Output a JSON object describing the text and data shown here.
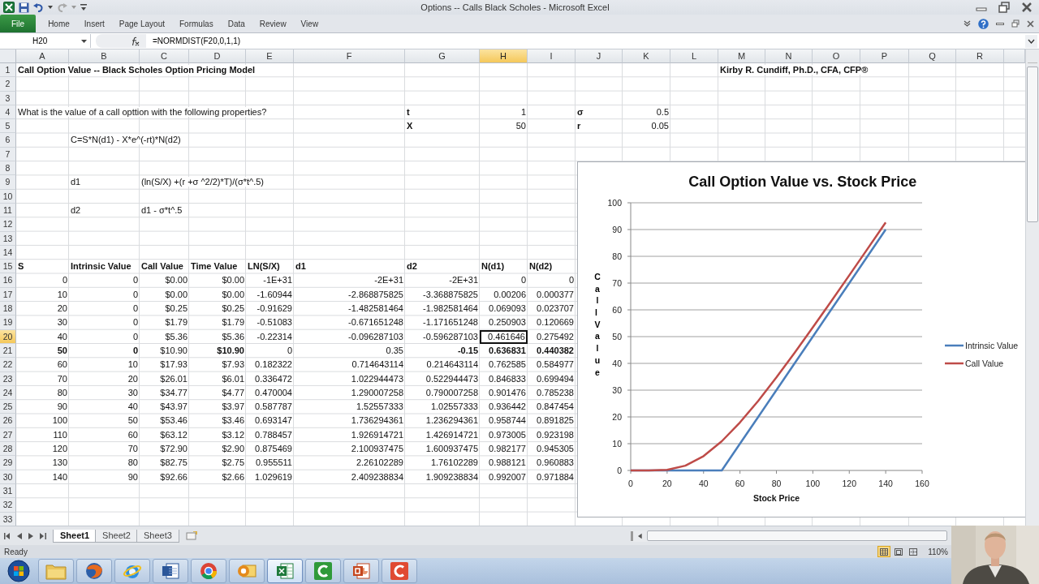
{
  "window": {
    "title": "Options -- Calls Black Scholes - Microsoft Excel"
  },
  "ribbon": {
    "tabs": [
      {
        "label": "File",
        "kind": "file"
      },
      {
        "label": "Home",
        "kind": "tab"
      },
      {
        "label": "Insert",
        "kind": "tab"
      },
      {
        "label": "Page Layout",
        "kind": "tab"
      },
      {
        "label": "Formulas",
        "kind": "tab"
      },
      {
        "label": "Data",
        "kind": "tab"
      },
      {
        "label": "Review",
        "kind": "tab"
      },
      {
        "label": "View",
        "kind": "tab"
      }
    ]
  },
  "formula_bar": {
    "name_box": "H20",
    "formula": "=NORMDIST(F20,0,1,1)"
  },
  "sheet": {
    "columns": [
      {
        "label": "A",
        "selected": false
      },
      {
        "label": "B",
        "selected": false
      },
      {
        "label": "C",
        "selected": false
      },
      {
        "label": "D",
        "selected": false
      },
      {
        "label": "E",
        "selected": false
      },
      {
        "label": "F",
        "selected": false
      },
      {
        "label": "G",
        "selected": false
      },
      {
        "label": "H",
        "selected": true
      },
      {
        "label": "I",
        "selected": false
      },
      {
        "label": "J",
        "selected": false
      },
      {
        "label": "K",
        "selected": false
      },
      {
        "label": "L",
        "selected": false
      },
      {
        "label": "M",
        "selected": false
      },
      {
        "label": "N",
        "selected": false
      },
      {
        "label": "O",
        "selected": false
      },
      {
        "label": "P",
        "selected": false
      },
      {
        "label": "Q",
        "selected": false
      },
      {
        "label": "R",
        "selected": false
      }
    ],
    "rows": [
      {
        "number": "1",
        "selected": false,
        "cells": [
          {
            "text": "Call Option Value -- Black Scholes Option Pricing Model",
            "kind": "text",
            "bold": true
          },
          null,
          null,
          null,
          null,
          null,
          null,
          null,
          null,
          null,
          null,
          null,
          {
            "text": "Kirby R. Cundiff, Ph.D., CFA, CFP®",
            "kind": "text",
            "bold": true
          }
        ]
      },
      {
        "number": "2",
        "selected": false,
        "cells": []
      },
      {
        "number": "3",
        "selected": false,
        "cells": []
      },
      {
        "number": "4",
        "selected": false,
        "cells": [
          {
            "text": "What is the value of a call opttion with the following properties?",
            "kind": "text",
            "bold": false
          },
          null,
          null,
          null,
          null,
          null,
          {
            "text": "t",
            "kind": "text",
            "bold": true
          },
          {
            "text": "1",
            "kind": "number",
            "bold": false
          },
          null,
          {
            "text": "σ",
            "kind": "text",
            "bold": true
          },
          {
            "text": "0.5",
            "kind": "number",
            "bold": false
          }
        ]
      },
      {
        "number": "5",
        "selected": false,
        "cells": [
          null,
          null,
          null,
          null,
          null,
          null,
          {
            "text": "X",
            "kind": "text",
            "bold": true
          },
          {
            "text": "50",
            "kind": "number",
            "bold": false
          },
          null,
          {
            "text": "r",
            "kind": "text",
            "bold": true
          },
          {
            "text": "0.05",
            "kind": "number",
            "bold": false
          }
        ]
      },
      {
        "number": "6",
        "selected": false,
        "cells": [
          null,
          {
            "text": "C=S*N(d1) - X*e^(-rt)*N(d2)",
            "kind": "text",
            "bold": false
          }
        ]
      },
      {
        "number": "7",
        "selected": false,
        "cells": []
      },
      {
        "number": "8",
        "selected": false,
        "cells": []
      },
      {
        "number": "9",
        "selected": false,
        "cells": [
          null,
          {
            "text": "d1",
            "kind": "text",
            "bold": false
          },
          {
            "text": "(ln(S/X) +(r +σ ^2/2)*T)/(σ*t^.5)",
            "kind": "text",
            "bold": false
          }
        ]
      },
      {
        "number": "10",
        "selected": false,
        "cells": []
      },
      {
        "number": "11",
        "selected": false,
        "cells": [
          null,
          {
            "text": "d2",
            "kind": "text",
            "bold": false
          },
          {
            "text": "d1 - σ*t^.5",
            "kind": "text",
            "bold": false
          }
        ]
      },
      {
        "number": "12",
        "selected": false,
        "cells": []
      },
      {
        "number": "13",
        "selected": false,
        "cells": []
      },
      {
        "number": "14",
        "selected": false,
        "cells": []
      },
      {
        "number": "15",
        "selected": false,
        "cells": [
          {
            "text": "S",
            "kind": "text",
            "bold": true
          },
          {
            "text": "Intrinsic Value",
            "kind": "text",
            "bold": true
          },
          {
            "text": "Call Value",
            "kind": "text",
            "bold": true
          },
          {
            "text": "Time Value",
            "kind": "text",
            "bold": true
          },
          {
            "text": "LN(S/X)",
            "kind": "text",
            "bold": true
          },
          {
            "text": "d1",
            "kind": "text",
            "bold": true
          },
          {
            "text": "d2",
            "kind": "text",
            "bold": true
          },
          {
            "text": "N(d1)",
            "kind": "text",
            "bold": true
          },
          {
            "text": "N(d2)",
            "kind": "text",
            "bold": true
          }
        ]
      },
      {
        "number": "16",
        "selected": false,
        "cells": [
          {
            "text": "0",
            "kind": "number",
            "bold": false
          },
          {
            "text": "0",
            "kind": "number",
            "bold": false
          },
          {
            "text": "$0.00",
            "kind": "number",
            "bold": false
          },
          {
            "text": "$0.00",
            "kind": "number",
            "bold": false
          },
          {
            "text": "-1E+31",
            "kind": "number",
            "bold": false
          },
          {
            "text": "-2E+31",
            "kind": "number",
            "bold": false
          },
          {
            "text": "-2E+31",
            "kind": "number",
            "bold": false
          },
          {
            "text": "0",
            "kind": "number",
            "bold": false
          },
          {
            "text": "0",
            "kind": "number",
            "bold": false
          }
        ]
      },
      {
        "number": "17",
        "selected": false,
        "cells": [
          {
            "text": "10",
            "kind": "number",
            "bold": false
          },
          {
            "text": "0",
            "kind": "number",
            "bold": false
          },
          {
            "text": "$0.00",
            "kind": "number",
            "bold": false
          },
          {
            "text": "$0.00",
            "kind": "number",
            "bold": false
          },
          {
            "text": "-1.60944",
            "kind": "number",
            "bold": false
          },
          {
            "text": "-2.868875825",
            "kind": "number",
            "bold": false
          },
          {
            "text": "-3.368875825",
            "kind": "number",
            "bold": false
          },
          {
            "text": "0.00206",
            "kind": "number",
            "bold": false
          },
          {
            "text": "0.000377",
            "kind": "number",
            "bold": false
          }
        ]
      },
      {
        "number": "18",
        "selected": false,
        "cells": [
          {
            "text": "20",
            "kind": "number",
            "bold": false
          },
          {
            "text": "0",
            "kind": "number",
            "bold": false
          },
          {
            "text": "$0.25",
            "kind": "number",
            "bold": false
          },
          {
            "text": "$0.25",
            "kind": "number",
            "bold": false
          },
          {
            "text": "-0.91629",
            "kind": "number",
            "bold": false
          },
          {
            "text": "-1.482581464",
            "kind": "number",
            "bold": false
          },
          {
            "text": "-1.982581464",
            "kind": "number",
            "bold": false
          },
          {
            "text": "0.069093",
            "kind": "number",
            "bold": false
          },
          {
            "text": "0.023707",
            "kind": "number",
            "bold": false
          }
        ]
      },
      {
        "number": "19",
        "selected": false,
        "cells": [
          {
            "text": "30",
            "kind": "number",
            "bold": false
          },
          {
            "text": "0",
            "kind": "number",
            "bold": false
          },
          {
            "text": "$1.79",
            "kind": "number",
            "bold": false
          },
          {
            "text": "$1.79",
            "kind": "number",
            "bold": false
          },
          {
            "text": "-0.51083",
            "kind": "number",
            "bold": false
          },
          {
            "text": "-0.671651248",
            "kind": "number",
            "bold": false
          },
          {
            "text": "-1.171651248",
            "kind": "number",
            "bold": false
          },
          {
            "text": "0.250903",
            "kind": "number",
            "bold": false
          },
          {
            "text": "0.120669",
            "kind": "number",
            "bold": false
          }
        ]
      },
      {
        "number": "20",
        "selected": true,
        "cells": [
          {
            "text": "40",
            "kind": "number",
            "bold": false
          },
          {
            "text": "0",
            "kind": "number",
            "bold": false
          },
          {
            "text": "$5.36",
            "kind": "number",
            "bold": false
          },
          {
            "text": "$5.36",
            "kind": "number",
            "bold": false
          },
          {
            "text": "-0.22314",
            "kind": "number",
            "bold": false
          },
          {
            "text": "-0.096287103",
            "kind": "number",
            "bold": false
          },
          {
            "text": "-0.596287103",
            "kind": "number",
            "bold": false
          },
          {
            "text": "0.461646",
            "kind": "number",
            "bold": false
          },
          {
            "text": "0.275492",
            "kind": "number",
            "bold": false
          }
        ]
      },
      {
        "number": "21",
        "selected": false,
        "cells": [
          {
            "text": "50",
            "kind": "number",
            "bold": true
          },
          {
            "text": "0",
            "kind": "number",
            "bold": true
          },
          {
            "text": "$10.90",
            "kind": "number",
            "bold": false
          },
          {
            "text": "$10.90",
            "kind": "number",
            "bold": true
          },
          {
            "text": "0",
            "kind": "number",
            "bold": false
          },
          {
            "text": "0.35",
            "kind": "number",
            "bold": false
          },
          {
            "text": "-0.15",
            "kind": "number",
            "bold": true
          },
          {
            "text": "0.636831",
            "kind": "number",
            "bold": true
          },
          {
            "text": "0.440382",
            "kind": "number",
            "bold": true
          }
        ]
      },
      {
        "number": "22",
        "selected": false,
        "cells": [
          {
            "text": "60",
            "kind": "number",
            "bold": false
          },
          {
            "text": "10",
            "kind": "number",
            "bold": false
          },
          {
            "text": "$17.93",
            "kind": "number",
            "bold": false
          },
          {
            "text": "$7.93",
            "kind": "number",
            "bold": false
          },
          {
            "text": "0.182322",
            "kind": "number",
            "bold": false
          },
          {
            "text": "0.714643114",
            "kind": "number",
            "bold": false
          },
          {
            "text": "0.214643114",
            "kind": "number",
            "bold": false
          },
          {
            "text": "0.762585",
            "kind": "number",
            "bold": false
          },
          {
            "text": "0.584977",
            "kind": "number",
            "bold": false
          }
        ]
      },
      {
        "number": "23",
        "selected": false,
        "cells": [
          {
            "text": "70",
            "kind": "number",
            "bold": false
          },
          {
            "text": "20",
            "kind": "number",
            "bold": false
          },
          {
            "text": "$26.01",
            "kind": "number",
            "bold": false
          },
          {
            "text": "$6.01",
            "kind": "number",
            "bold": false
          },
          {
            "text": "0.336472",
            "kind": "number",
            "bold": false
          },
          {
            "text": "1.022944473",
            "kind": "number",
            "bold": false
          },
          {
            "text": "0.522944473",
            "kind": "number",
            "bold": false
          },
          {
            "text": "0.846833",
            "kind": "number",
            "bold": false
          },
          {
            "text": "0.699494",
            "kind": "number",
            "bold": false
          }
        ]
      },
      {
        "number": "24",
        "selected": false,
        "cells": [
          {
            "text": "80",
            "kind": "number",
            "bold": false
          },
          {
            "text": "30",
            "kind": "number",
            "bold": false
          },
          {
            "text": "$34.77",
            "kind": "number",
            "bold": false
          },
          {
            "text": "$4.77",
            "kind": "number",
            "bold": false
          },
          {
            "text": "0.470004",
            "kind": "number",
            "bold": false
          },
          {
            "text": "1.290007258",
            "kind": "number",
            "bold": false
          },
          {
            "text": "0.790007258",
            "kind": "number",
            "bold": false
          },
          {
            "text": "0.901476",
            "kind": "number",
            "bold": false
          },
          {
            "text": "0.785238",
            "kind": "number",
            "bold": false
          }
        ]
      },
      {
        "number": "25",
        "selected": false,
        "cells": [
          {
            "text": "90",
            "kind": "number",
            "bold": false
          },
          {
            "text": "40",
            "kind": "number",
            "bold": false
          },
          {
            "text": "$43.97",
            "kind": "number",
            "bold": false
          },
          {
            "text": "$3.97",
            "kind": "number",
            "bold": false
          },
          {
            "text": "0.587787",
            "kind": "number",
            "bold": false
          },
          {
            "text": "1.52557333",
            "kind": "number",
            "bold": false
          },
          {
            "text": "1.02557333",
            "kind": "number",
            "bold": false
          },
          {
            "text": "0.936442",
            "kind": "number",
            "bold": false
          },
          {
            "text": "0.847454",
            "kind": "number",
            "bold": false
          }
        ]
      },
      {
        "number": "26",
        "selected": false,
        "cells": [
          {
            "text": "100",
            "kind": "number",
            "bold": false
          },
          {
            "text": "50",
            "kind": "number",
            "bold": false
          },
          {
            "text": "$53.46",
            "kind": "number",
            "bold": false
          },
          {
            "text": "$3.46",
            "kind": "number",
            "bold": false
          },
          {
            "text": "0.693147",
            "kind": "number",
            "bold": false
          },
          {
            "text": "1.736294361",
            "kind": "number",
            "bold": false
          },
          {
            "text": "1.236294361",
            "kind": "number",
            "bold": false
          },
          {
            "text": "0.958744",
            "kind": "number",
            "bold": false
          },
          {
            "text": "0.891825",
            "kind": "number",
            "bold": false
          }
        ]
      },
      {
        "number": "27",
        "selected": false,
        "cells": [
          {
            "text": "110",
            "kind": "number",
            "bold": false
          },
          {
            "text": "60",
            "kind": "number",
            "bold": false
          },
          {
            "text": "$63.12",
            "kind": "number",
            "bold": false
          },
          {
            "text": "$3.12",
            "kind": "number",
            "bold": false
          },
          {
            "text": "0.788457",
            "kind": "number",
            "bold": false
          },
          {
            "text": "1.926914721",
            "kind": "number",
            "bold": false
          },
          {
            "text": "1.426914721",
            "kind": "number",
            "bold": false
          },
          {
            "text": "0.973005",
            "kind": "number",
            "bold": false
          },
          {
            "text": "0.923198",
            "kind": "number",
            "bold": false
          }
        ]
      },
      {
        "number": "28",
        "selected": false,
        "cells": [
          {
            "text": "120",
            "kind": "number",
            "bold": false
          },
          {
            "text": "70",
            "kind": "number",
            "bold": false
          },
          {
            "text": "$72.90",
            "kind": "number",
            "bold": false
          },
          {
            "text": "$2.90",
            "kind": "number",
            "bold": false
          },
          {
            "text": "0.875469",
            "kind": "number",
            "bold": false
          },
          {
            "text": "2.100937475",
            "kind": "number",
            "bold": false
          },
          {
            "text": "1.600937475",
            "kind": "number",
            "bold": false
          },
          {
            "text": "0.982177",
            "kind": "number",
            "bold": false
          },
          {
            "text": "0.945305",
            "kind": "number",
            "bold": false
          }
        ]
      },
      {
        "number": "29",
        "selected": false,
        "cells": [
          {
            "text": "130",
            "kind": "number",
            "bold": false
          },
          {
            "text": "80",
            "kind": "number",
            "bold": false
          },
          {
            "text": "$82.75",
            "kind": "number",
            "bold": false
          },
          {
            "text": "$2.75",
            "kind": "number",
            "bold": false
          },
          {
            "text": "0.955511",
            "kind": "number",
            "bold": false
          },
          {
            "text": "2.26102289",
            "kind": "number",
            "bold": false
          },
          {
            "text": "1.76102289",
            "kind": "number",
            "bold": false
          },
          {
            "text": "0.988121",
            "kind": "number",
            "bold": false
          },
          {
            "text": "0.960883",
            "kind": "number",
            "bold": false
          }
        ]
      },
      {
        "number": "30",
        "selected": false,
        "cells": [
          {
            "text": "140",
            "kind": "number",
            "bold": false
          },
          {
            "text": "90",
            "kind": "number",
            "bold": false
          },
          {
            "text": "$92.66",
            "kind": "number",
            "bold": false
          },
          {
            "text": "$2.66",
            "kind": "number",
            "bold": false
          },
          {
            "text": "1.029619",
            "kind": "number",
            "bold": false
          },
          {
            "text": "2.409238834",
            "kind": "number",
            "bold": false
          },
          {
            "text": "1.909238834",
            "kind": "number",
            "bold": false
          },
          {
            "text": "0.992007",
            "kind": "number",
            "bold": false
          },
          {
            "text": "0.971884",
            "kind": "number",
            "bold": false
          }
        ]
      },
      {
        "number": "31",
        "selected": false,
        "cells": []
      },
      {
        "number": "32",
        "selected": false,
        "cells": []
      },
      {
        "number": "33",
        "selected": false,
        "cells": []
      }
    ]
  },
  "chart": {
    "chart_data": {
      "type": "line",
      "title": "Call Option Value vs. Stock Price",
      "xlabel": "Stock Price",
      "ylabel": "Call Value",
      "x": [
        0,
        10,
        20,
        30,
        40,
        50,
        60,
        70,
        80,
        90,
        100,
        110,
        120,
        130,
        140
      ],
      "series": [
        {
          "name": "Intrinsic Value",
          "color": "#4a7ebb",
          "values": [
            0,
            0,
            0,
            0,
            0,
            0,
            10,
            20,
            30,
            40,
            50,
            60,
            70,
            80,
            90
          ]
        },
        {
          "name": "Call Value",
          "color": "#be4b48",
          "values": [
            0,
            0,
            0.25,
            1.79,
            5.36,
            10.9,
            17.93,
            26.01,
            34.77,
            43.97,
            53.46,
            63.12,
            72.9,
            82.75,
            92.66
          ]
        }
      ],
      "xlim": [
        0,
        160
      ],
      "ylim": [
        0,
        100
      ],
      "xticks": [
        {
          "value": 0,
          "label": "0"
        },
        {
          "value": 20,
          "label": "20"
        },
        {
          "value": 40,
          "label": "40"
        },
        {
          "value": 60,
          "label": "60"
        },
        {
          "value": 80,
          "label": "80"
        },
        {
          "value": 100,
          "label": "100"
        },
        {
          "value": 120,
          "label": "120"
        },
        {
          "value": 140,
          "label": "140"
        },
        {
          "value": 160,
          "label": "160"
        }
      ],
      "yticks": [
        {
          "value": 0,
          "label": "0"
        },
        {
          "value": 10,
          "label": "10"
        },
        {
          "value": 20,
          "label": "20"
        },
        {
          "value": 30,
          "label": "30"
        },
        {
          "value": 40,
          "label": "40"
        },
        {
          "value": 50,
          "label": "50"
        },
        {
          "value": 60,
          "label": "60"
        },
        {
          "value": 70,
          "label": "70"
        },
        {
          "value": 80,
          "label": "80"
        },
        {
          "value": 90,
          "label": "90"
        },
        {
          "value": 100,
          "label": "100"
        }
      ],
      "grid": true,
      "legend": "right"
    }
  },
  "sheet_tabs": [
    {
      "label": "Sheet1",
      "selected": true
    },
    {
      "label": "Sheet2",
      "selected": false
    },
    {
      "label": "Sheet3",
      "selected": false
    }
  ],
  "status_bar": {
    "text": "Ready",
    "views": [
      {
        "kind": "normal",
        "selected": true
      },
      {
        "kind": "page-layout",
        "selected": false
      },
      {
        "kind": "page-break",
        "selected": false
      }
    ],
    "zoom": "110%"
  },
  "taskbar": [
    {
      "kind": "folder",
      "selected": false
    },
    {
      "kind": "fox",
      "selected": false
    },
    {
      "kind": "ie",
      "selected": false
    },
    {
      "kind": "word",
      "selected": false
    },
    {
      "kind": "chrome",
      "selected": false
    },
    {
      "kind": "outlook",
      "selected": false
    },
    {
      "kind": "excel",
      "selected": true
    },
    {
      "kind": "green-c",
      "selected": false
    },
    {
      "kind": "powerpoint",
      "selected": false
    },
    {
      "kind": "red-c",
      "selected": false
    }
  ]
}
